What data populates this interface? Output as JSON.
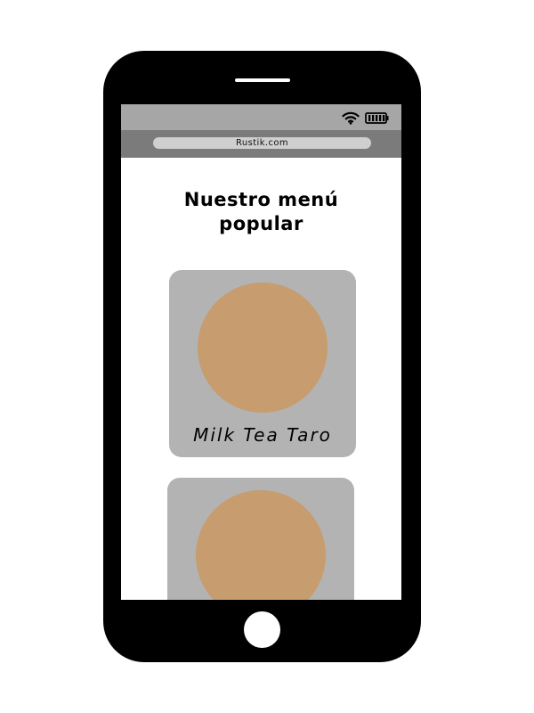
{
  "browser": {
    "url": "Rustik.com"
  },
  "status_bar": {
    "icons": [
      "wifi-icon",
      "battery-icon"
    ]
  },
  "page": {
    "title": "Nuestro menú popular"
  },
  "menu_items": [
    {
      "name": "Milk Tea Taro",
      "image_color": "#c79c6e"
    },
    {
      "name": "",
      "image_color": "#c79c6e"
    }
  ],
  "colors": {
    "phone_body": "#000000",
    "status_bar": "#a6a6a6",
    "address_bar": "#7b7b7b",
    "url_pill": "#cfcfcf",
    "card": "#b3b3b3",
    "product_image": "#c79c6e"
  }
}
